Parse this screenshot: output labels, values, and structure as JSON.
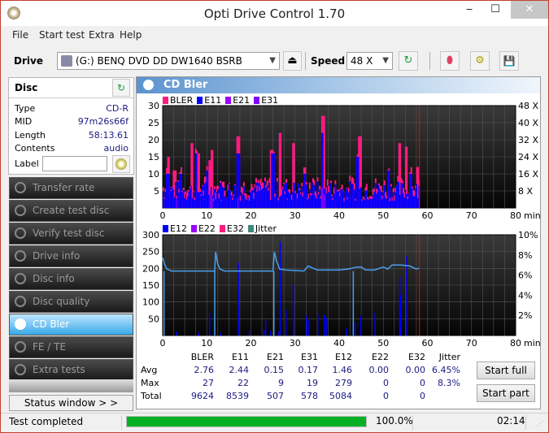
{
  "window": {
    "title": "Opti Drive Control 1.70",
    "minimize": "‒",
    "maximize": "☐",
    "close": "✕"
  },
  "menu": [
    "File",
    "Start test",
    "Extra",
    "Help"
  ],
  "toolbar": {
    "drive_label": "Drive",
    "drive_value": "(G:)  BENQ DVD DD DW1640 BSRB",
    "speed_label": "Speed",
    "speed_value": "48 X",
    "eject_icon": "⏏",
    "refresh_icon": "↻",
    "erase_icon": "⬮",
    "settings_icon": "⚙",
    "save_icon": "💾"
  },
  "disc": {
    "title": "Disc",
    "fields": [
      {
        "key": "Type",
        "value": "CD-R"
      },
      {
        "key": "MID",
        "value": "97m26s66f"
      },
      {
        "key": "Length",
        "value": "58:13.61"
      },
      {
        "key": "Contents",
        "value": "audio"
      }
    ],
    "label_key": "Label",
    "label_value": ""
  },
  "nav": [
    {
      "label": "Transfer rate",
      "active": false
    },
    {
      "label": "Create test disc",
      "active": false
    },
    {
      "label": "Verify test disc",
      "active": false
    },
    {
      "label": "Drive info",
      "active": false
    },
    {
      "label": "Disc info",
      "active": false
    },
    {
      "label": "Disc quality",
      "active": false
    },
    {
      "label": "CD Bler",
      "active": true
    },
    {
      "label": "FE / TE",
      "active": false
    },
    {
      "label": "Extra tests",
      "active": false
    }
  ],
  "status_window_button": "Status window > >",
  "main": {
    "title": "CD Bler"
  },
  "chart_data": [
    {
      "type": "bar",
      "title": "BLER / E11 / E21 / E31",
      "legend": [
        {
          "name": "BLER",
          "color": "#ff1a80"
        },
        {
          "name": "E11",
          "color": "#0000ff"
        },
        {
          "name": "E21",
          "color": "#9900ff"
        },
        {
          "name": "E31",
          "color": "#8000ff"
        }
      ],
      "xlabel": "min",
      "xlim": [
        0,
        80
      ],
      "xticks": [
        0,
        10,
        20,
        30,
        40,
        50,
        60,
        70,
        80
      ],
      "ylim": [
        0,
        30
      ],
      "yticks": [
        5,
        10,
        15,
        20,
        25,
        30
      ],
      "y2ticks": [
        "8 X",
        "16 X",
        "24 X",
        "32 X",
        "40 X",
        "48 X"
      ],
      "end_marker_min": 58.2,
      "series": [
        {
          "name": "BLER",
          "peaks": [
            [
              1.2,
              15
            ],
            [
              2.5,
              11
            ],
            [
              6.5,
              19
            ],
            [
              8,
              16
            ],
            [
              10.5,
              14
            ],
            [
              11,
              17
            ],
            [
              17,
              21
            ],
            [
              24.5,
              17
            ],
            [
              26.5,
              22
            ],
            [
              29.5,
              19
            ],
            [
              36.2,
              27
            ],
            [
              44.5,
              21
            ],
            [
              53.5,
              19
            ],
            [
              55,
              18
            ],
            [
              57.5,
              12
            ]
          ]
        },
        {
          "name": "E11",
          "peaks": [
            [
              1,
              10
            ],
            [
              4,
              10
            ],
            [
              7.5,
              16
            ],
            [
              10,
              11
            ],
            [
              17,
              16
            ],
            [
              24.8,
              16
            ],
            [
              32,
              10
            ],
            [
              36,
              22
            ],
            [
              44,
              15
            ],
            [
              51,
              11
            ],
            [
              56,
              10
            ]
          ],
          "baseline": 4
        },
        {
          "name": "E21",
          "peaks": [
            [
              3,
              3
            ],
            [
              11,
              4
            ],
            [
              17,
              3
            ],
            [
              36,
              6
            ]
          ]
        },
        {
          "name": "E31",
          "peaks": [
            [
              10.8,
              5
            ],
            [
              17,
              16
            ],
            [
              36.5,
              4
            ]
          ]
        }
      ]
    },
    {
      "type": "bar",
      "title": "E12 / E22 / E32 / Jitter",
      "legend": [
        {
          "name": "E12",
          "color": "#0000ff"
        },
        {
          "name": "E22",
          "color": "#9900ff"
        },
        {
          "name": "E32",
          "color": "#ff1a80"
        },
        {
          "name": "Jitter",
          "color": "#3d8a80"
        }
      ],
      "xlabel": "min",
      "xlim": [
        0,
        80
      ],
      "xticks": [
        0,
        10,
        20,
        30,
        40,
        50,
        60,
        70,
        80
      ],
      "ylim": [
        0,
        300
      ],
      "yticks": [
        50,
        100,
        150,
        200,
        250,
        300
      ],
      "y2lim": [
        0,
        10
      ],
      "y2ticks": [
        "2%",
        "4%",
        "6%",
        "8%",
        "10%"
      ],
      "end_marker_min": 58.2,
      "series": [
        {
          "name": "E12",
          "peaks": [
            [
              3,
              12
            ],
            [
              8,
              8
            ],
            [
              10.5,
              67
            ],
            [
              13,
              8
            ],
            [
              17,
              217
            ],
            [
              19.5,
              14
            ],
            [
              22.8,
              18
            ],
            [
              23.2,
              48
            ],
            [
              24.3,
              14
            ],
            [
              26.2,
              12
            ],
            [
              26.5,
              279
            ],
            [
              27.8,
              76
            ],
            [
              29.5,
              153
            ],
            [
              32.5,
              60
            ],
            [
              33,
              45
            ],
            [
              35,
              64
            ],
            [
              36.5,
              62
            ],
            [
              37,
              52
            ],
            [
              41.5,
              20
            ],
            [
              43.5,
              40
            ],
            [
              44.8,
              60
            ],
            [
              48,
              68
            ],
            [
              53.6,
              175
            ],
            [
              53.8,
              120
            ],
            [
              55.2,
              236
            ]
          ]
        },
        {
          "name": "Jitter",
          "points_pct": [
            [
              0,
              7.7
            ],
            [
              0.5,
              7.0
            ],
            [
              1,
              6.6
            ],
            [
              2,
              6.4
            ],
            [
              5,
              6.4
            ],
            [
              11.8,
              6.4
            ],
            [
              12,
              8.3
            ],
            [
              12.5,
              7.1
            ],
            [
              13,
              6.6
            ],
            [
              14,
              6.4
            ],
            [
              25,
              6.4
            ],
            [
              25.3,
              8.3
            ],
            [
              25.8,
              7.4
            ],
            [
              26.5,
              6.6
            ],
            [
              28,
              6.5
            ],
            [
              32,
              6.4
            ],
            [
              33,
              6.9
            ],
            [
              34,
              6.7
            ],
            [
              35,
              6.5
            ],
            [
              40,
              6.5
            ],
            [
              42,
              6.6
            ],
            [
              44,
              6.8
            ],
            [
              45,
              6.8
            ],
            [
              46,
              6.5
            ],
            [
              48,
              6.5
            ],
            [
              50,
              6.8
            ],
            [
              51,
              6.6
            ],
            [
              52,
              7.0
            ],
            [
              54,
              7.0
            ],
            [
              56,
              6.9
            ],
            [
              57.5,
              6.6
            ],
            [
              58.2,
              6.7
            ]
          ],
          "dropouts_min": [
            0.3,
            11.8,
            25.2,
            43.2
          ]
        }
      ]
    }
  ],
  "stats": {
    "columns": [
      "BLER",
      "E11",
      "E21",
      "E31",
      "E12",
      "E22",
      "E32",
      "Jitter"
    ],
    "rows": [
      {
        "label": "Avg",
        "values": [
          "2.76",
          "2.44",
          "0.15",
          "0.17",
          "1.46",
          "0.00",
          "0.00",
          "6.45%"
        ]
      },
      {
        "label": "Max",
        "values": [
          "27",
          "22",
          "9",
          "19",
          "279",
          "0",
          "0",
          "8.3%"
        ]
      },
      {
        "label": "Total",
        "values": [
          "9624",
          "8539",
          "507",
          "578",
          "5084",
          "0",
          "0",
          ""
        ]
      }
    ]
  },
  "buttons": {
    "start_full": "Start full",
    "start_part": "Start part"
  },
  "status": {
    "text": "Test completed",
    "progress": 1.0,
    "percent": "100.0%",
    "time": "02:14"
  }
}
